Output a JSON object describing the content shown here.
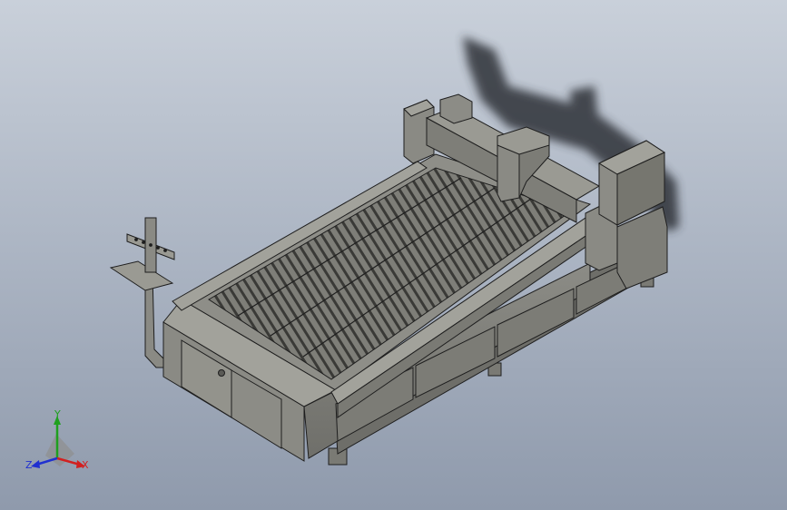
{
  "viewport": {
    "background_top": "#c9d0da",
    "background_bottom": "#8f9aac"
  },
  "model": {
    "body_color": "#8a8a84",
    "body_dark": "#6e6e69",
    "body_light": "#a2a29b",
    "edge_color": "#1e1e1e",
    "shadow_color": "#2f3338"
  },
  "triad": {
    "x_label": "X",
    "y_label": "Y",
    "z_label": "Z",
    "x_color": "#d22020",
    "y_color": "#1fa01f",
    "z_color": "#2030d0"
  }
}
